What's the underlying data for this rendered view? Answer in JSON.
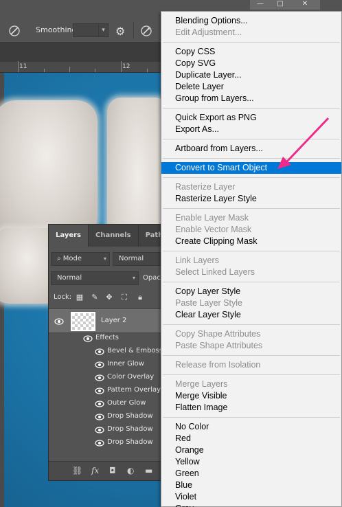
{
  "options_bar": {
    "smoothing_label": "Smoothing:",
    "smoothing_value": "",
    "tool_icon": "brush-icon",
    "settings_icon": "gear-icon",
    "symmetry_icon": "brush-pressure-icon"
  },
  "window_controls": {
    "minimize": "—",
    "maximize": "□",
    "close": "✕"
  },
  "ruler": {
    "marks": [
      "11",
      "12"
    ]
  },
  "layers_panel": {
    "tabs": [
      "Layers",
      "Channels",
      "Paths"
    ],
    "active_tab": "Layers",
    "filter_kind": "Mode",
    "filter_value": "Normal",
    "blend_mode": "Normal",
    "opacity_label": "Opac",
    "lock_label": "Lock:",
    "layer_name": "Layer 2",
    "effects_label": "Effects",
    "effects": [
      "Bevel & Emboss",
      "Inner Glow",
      "Color Overlay",
      "Pattern Overlay",
      "Outer Glow",
      "Drop Shadow",
      "Drop Shadow",
      "Drop Shadow"
    ]
  },
  "context_menu": {
    "groups": [
      [
        {
          "label": "Blending Options...",
          "enabled": true
        },
        {
          "label": "Edit Adjustment...",
          "enabled": false
        }
      ],
      [
        {
          "label": "Copy CSS",
          "enabled": true
        },
        {
          "label": "Copy SVG",
          "enabled": true
        },
        {
          "label": "Duplicate Layer...",
          "enabled": true
        },
        {
          "label": "Delete Layer",
          "enabled": true
        },
        {
          "label": "Group from Layers...",
          "enabled": true
        }
      ],
      [
        {
          "label": "Quick Export as PNG",
          "enabled": true
        },
        {
          "label": "Export As...",
          "enabled": true
        }
      ],
      [
        {
          "label": "Artboard from Layers...",
          "enabled": true
        }
      ],
      [
        {
          "label": "Convert to Smart Object",
          "enabled": true,
          "highlighted": true
        }
      ],
      [
        {
          "label": "Rasterize Layer",
          "enabled": false
        },
        {
          "label": "Rasterize Layer Style",
          "enabled": true
        }
      ],
      [
        {
          "label": "Enable Layer Mask",
          "enabled": false
        },
        {
          "label": "Enable Vector Mask",
          "enabled": false
        },
        {
          "label": "Create Clipping Mask",
          "enabled": true
        }
      ],
      [
        {
          "label": "Link Layers",
          "enabled": false
        },
        {
          "label": "Select Linked Layers",
          "enabled": false
        }
      ],
      [
        {
          "label": "Copy Layer Style",
          "enabled": true
        },
        {
          "label": "Paste Layer Style",
          "enabled": false
        },
        {
          "label": "Clear Layer Style",
          "enabled": true
        }
      ],
      [
        {
          "label": "Copy Shape Attributes",
          "enabled": false
        },
        {
          "label": "Paste Shape Attributes",
          "enabled": false
        }
      ],
      [
        {
          "label": "Release from Isolation",
          "enabled": false
        }
      ],
      [
        {
          "label": "Merge Layers",
          "enabled": false
        },
        {
          "label": "Merge Visible",
          "enabled": true
        },
        {
          "label": "Flatten Image",
          "enabled": true
        }
      ],
      [
        {
          "label": "No Color",
          "enabled": true
        },
        {
          "label": "Red",
          "enabled": true
        },
        {
          "label": "Orange",
          "enabled": true
        },
        {
          "label": "Yellow",
          "enabled": true
        },
        {
          "label": "Green",
          "enabled": true
        },
        {
          "label": "Blue",
          "enabled": true
        },
        {
          "label": "Violet",
          "enabled": true
        },
        {
          "label": "Gray",
          "enabled": true
        }
      ]
    ],
    "highlight_color": "#0078d7"
  },
  "annotation": {
    "arrow_color": "#ee2a8b",
    "target": "Convert to Smart Object"
  }
}
